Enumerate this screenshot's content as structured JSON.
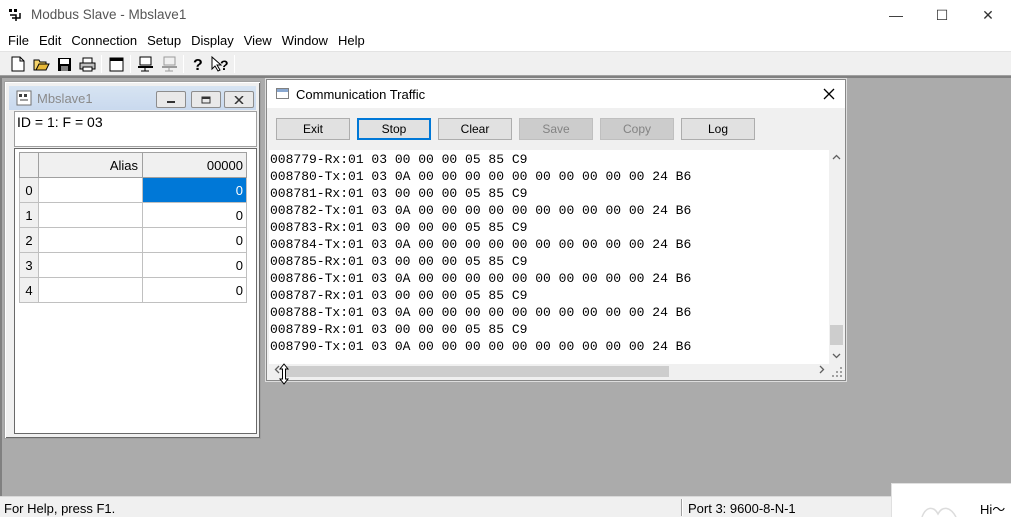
{
  "app": {
    "title": "Modbus Slave - Mbslave1",
    "window_controls": {
      "minimize": "—",
      "maximize": "☐",
      "close": "✕"
    }
  },
  "menu": [
    "File",
    "Edit",
    "Connection",
    "Setup",
    "Display",
    "View",
    "Window",
    "Help"
  ],
  "toolbar": {
    "icons": [
      "new-document-icon",
      "open-folder-icon",
      "save-icon",
      "print-icon",
      "window-icon",
      "connect-icon",
      "disconnect-icon",
      "help-icon",
      "context-help-icon"
    ]
  },
  "slave_window": {
    "title": "Mbslave1",
    "id_line": "ID = 1: F = 03",
    "grid": {
      "headers": {
        "alias": "Alias",
        "value": "00000"
      },
      "rows": [
        {
          "index": "0",
          "alias": "",
          "value": "0",
          "selected": true
        },
        {
          "index": "1",
          "alias": "",
          "value": "0",
          "selected": false
        },
        {
          "index": "2",
          "alias": "",
          "value": "0",
          "selected": false
        },
        {
          "index": "3",
          "alias": "",
          "value": "0",
          "selected": false
        },
        {
          "index": "4",
          "alias": "",
          "value": "0",
          "selected": false
        }
      ]
    }
  },
  "traffic": {
    "title": "Communication Traffic",
    "buttons": {
      "exit": "Exit",
      "stop": "Stop",
      "clear": "Clear",
      "save": "Save",
      "copy": "Copy",
      "log": "Log"
    },
    "lines": [
      "008779-Rx:01 03 00 00 00 05 85 C9",
      "008780-Tx:01 03 0A 00 00 00 00 00 00 00 00 00 00 24 B6",
      "008781-Rx:01 03 00 00 00 05 85 C9",
      "008782-Tx:01 03 0A 00 00 00 00 00 00 00 00 00 00 24 B6",
      "008783-Rx:01 03 00 00 00 05 85 C9",
      "008784-Tx:01 03 0A 00 00 00 00 00 00 00 00 00 00 24 B6",
      "008785-Rx:01 03 00 00 00 05 85 C9",
      "008786-Tx:01 03 0A 00 00 00 00 00 00 00 00 00 00 24 B6",
      "008787-Rx:01 03 00 00 00 05 85 C9",
      "008788-Tx:01 03 0A 00 00 00 00 00 00 00 00 00 00 24 B6",
      "008789-Rx:01 03 00 00 00 05 85 C9",
      "008790-Tx:01 03 0A 00 00 00 00 00 00 00 00 00 00 24 B6"
    ]
  },
  "status": {
    "help": "For Help, press F1.",
    "port": "Port 3: 9600-8-N-1"
  },
  "popup": {
    "text": "Hi～"
  }
}
